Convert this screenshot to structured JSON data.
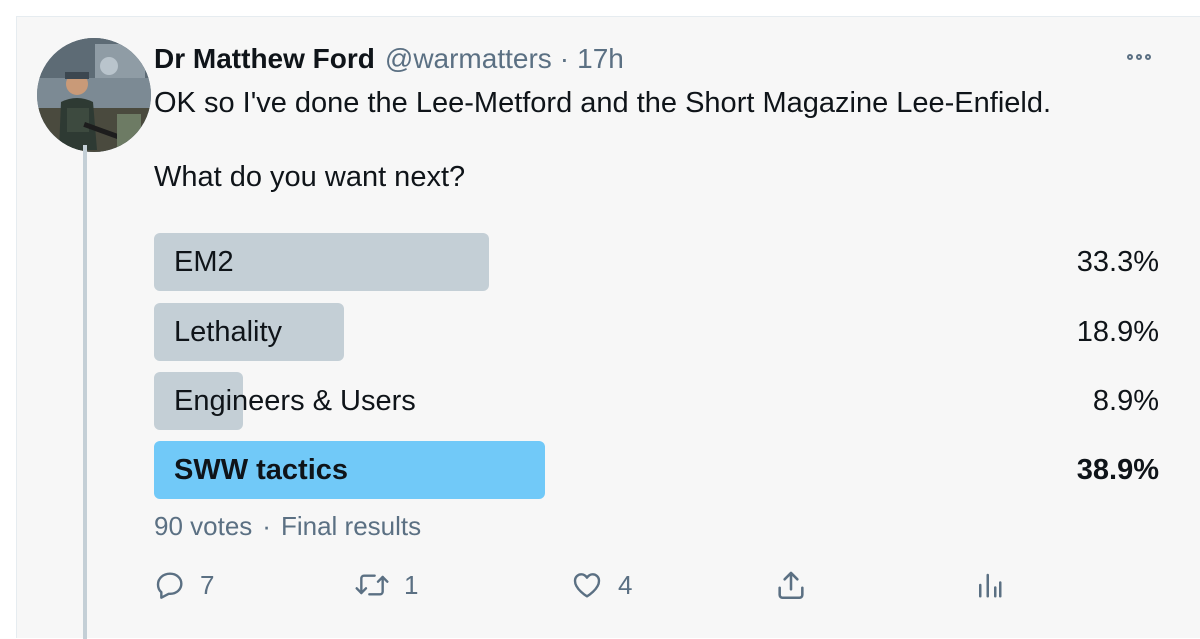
{
  "tweet": {
    "author_name": "Dr Matthew Ford",
    "handle": "@warmatters",
    "separator": "·",
    "time": "17h",
    "text_line1": "OK so I've done the Lee-Metford and the Short Magazine Lee-Enfield.",
    "text_line2": "What do you want next?"
  },
  "poll": {
    "options": [
      {
        "label": "EM2",
        "percent_text": "33.3%",
        "percent": 33.3,
        "winner": false
      },
      {
        "label": "Lethality",
        "percent_text": "18.9%",
        "percent": 18.9,
        "winner": false
      },
      {
        "label": "Engineers & Users",
        "percent_text": "8.9%",
        "percent": 8.9,
        "winner": false
      },
      {
        "label": "SWW tactics",
        "percent_text": "38.9%",
        "percent": 38.9,
        "winner": true
      }
    ],
    "votes": "90 votes",
    "separator": "·",
    "status": "Final results",
    "bar_color": "#c4cfd6",
    "winner_color": "#71c9f8"
  },
  "actions": {
    "reply_count": "7",
    "retweet_count": "1",
    "like_count": "4",
    "icons": [
      "reply-icon",
      "retweet-icon",
      "like-icon",
      "share-icon",
      "analytics-icon",
      "more-icon"
    ]
  }
}
